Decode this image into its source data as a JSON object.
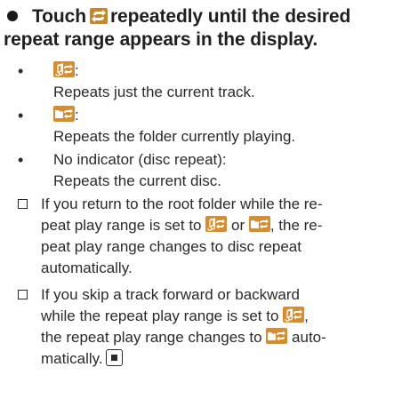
{
  "step": {
    "before_icon": "Touch",
    "after_icon": "repeatedly until the desired",
    "line2": "repeat range appears in the display.",
    "icon": "repeat-icon"
  },
  "bullets": [
    {
      "icon": "track-repeat-icon",
      "lead_suffix": ":",
      "desc": "Repeats just the current track."
    },
    {
      "icon": "folder-repeat-icon",
      "lead_suffix": ":",
      "desc": "Repeats the folder currently playing."
    },
    {
      "lead": "No indicator (disc repeat):",
      "desc": "Repeats the current disc."
    }
  ],
  "notes": [
    {
      "l1": "If you return to the root folder while the re-",
      "l2a": "peat play range is set to",
      "l2b": "or",
      "l2c": ", the re-",
      "l3": "peat play range changes to disc repeat",
      "l4": "automatically."
    },
    {
      "l1": "If you skip a track forward or backward",
      "l2a": "while the repeat play range is set to",
      "l2b": ",",
      "l3a": "the repeat play range changes to",
      "l3b": "auto-",
      "l4": "matically."
    }
  ],
  "symbols": {
    "bullet": "•",
    "end_mark": "end-of-section-icon"
  },
  "colors": {
    "icon_orange": "#d98c2c",
    "icon_dark_orange": "#c8862a",
    "text": "#2a2a2a"
  }
}
